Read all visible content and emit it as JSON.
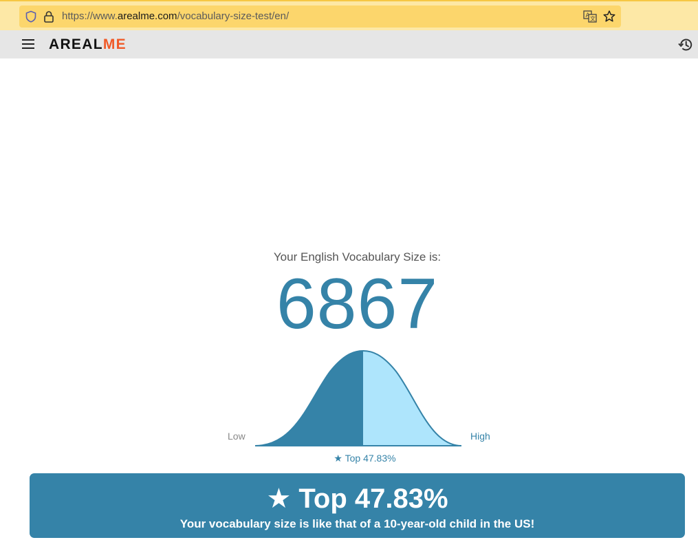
{
  "browser": {
    "url_prefix": "https://www.",
    "url_domain": "arealme.com",
    "url_path": "/vocabulary-size-test/en/"
  },
  "site": {
    "logo_part1": "AREAL",
    "logo_part2": "ME",
    "icons": [
      "menu-icon",
      "history-icon"
    ]
  },
  "result": {
    "label": "Your English Vocabulary Size is:",
    "score": "6867",
    "low_label": "Low",
    "high_label": "High",
    "curve_caption": "★ Top 47.83%",
    "percentile_top": 47.83
  },
  "banner": {
    "title": "★ Top 47.83%",
    "subtitle": "Your vocabulary size is like that of a 10-year-old child in the US!"
  },
  "colors": {
    "accent": "#3583a8",
    "curve_light": "#aee5fc",
    "logo_accent": "#f05a28",
    "url_bar": "#fcd66c"
  }
}
